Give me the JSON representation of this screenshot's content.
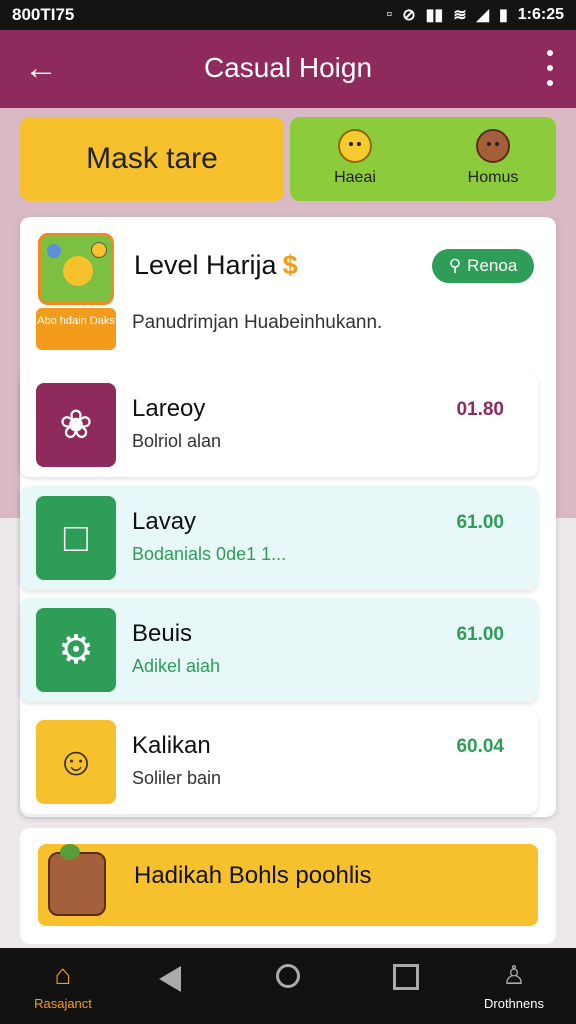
{
  "status_bar": {
    "left_text": "800TI75",
    "time": "1:6:25",
    "icons": [
      "lock-icon",
      "mute-icon",
      "signal-icon",
      "wifi-icon",
      "cell-signal-icon",
      "battery-icon"
    ]
  },
  "app_bar": {
    "title": "Casual Hoign",
    "back_icon": "arrow-left-icon",
    "menu_icon": "more-vertical-icon",
    "color": "#8e2a5c"
  },
  "top_tiles": {
    "yellow_label": "Mask tare",
    "green_items": [
      {
        "label": "Haeai",
        "icon": "smile-face-icon"
      },
      {
        "label": "Homus",
        "icon": "brown-face-icon"
      }
    ]
  },
  "hero": {
    "title": "Level Harija",
    "coin_icon": "$",
    "badge_text": "Abo hdain Daks",
    "subtitle": "Panudrimjan Huabeinhukann.",
    "pill_label": "Renoa",
    "pill_icon": "search-icon"
  },
  "rows": [
    {
      "name": "Lareoy",
      "desc": "Bolriol alan",
      "value": "01.80",
      "icon": "flower-icon",
      "color": "#8e2a5c"
    },
    {
      "name": "Lavay",
      "desc": "Bodanials 0de1 1...",
      "value": "61.00",
      "icon": "folder-icon",
      "color": "#2e9d57"
    },
    {
      "name": "Beuis",
      "desc": "Adikel aiah",
      "value": "61.00",
      "icon": "gear-icon",
      "color": "#2e9d57"
    },
    {
      "name": "Kalikan",
      "desc": "Soliler bain",
      "value": "60.04",
      "icon": "smile-icon",
      "color": "#f6c12c"
    }
  ],
  "banner": {
    "text": "Hadikah Bohls poohlis",
    "color": "#f6c12c"
  },
  "nav": {
    "home_label": "Rasajanct",
    "right_label": "Drothnens"
  }
}
